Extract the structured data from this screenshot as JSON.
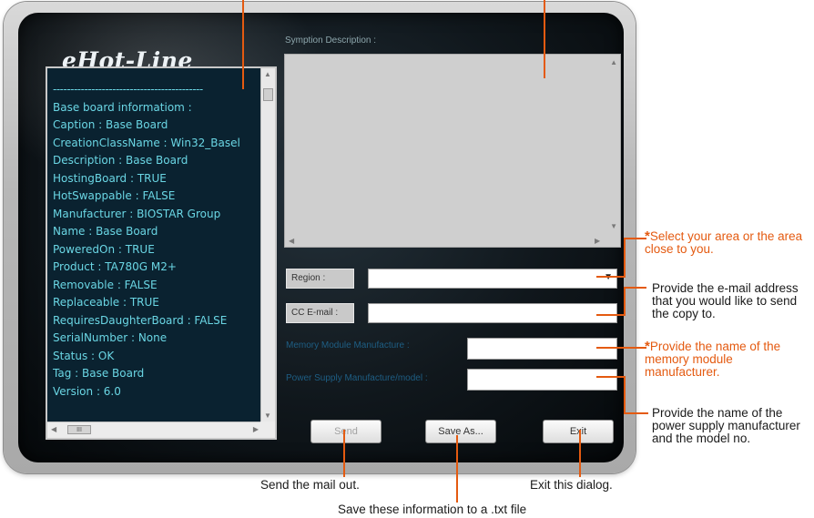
{
  "window": {
    "title": "eHot-Line"
  },
  "info_list": {
    "separator": "-------------------------------------------",
    "lines": [
      "Base board informatiom :",
      "Caption : Base Board",
      "CreationClassName : Win32_Basel",
      "Description : Base Board",
      "HostingBoard : TRUE",
      "HotSwappable : FALSE",
      "Manufacturer : BIOSTAR Group",
      "Name : Base Board",
      "PoweredOn : TRUE",
      "Product : TA780G M2+",
      "Removable : FALSE",
      "Replaceable : TRUE",
      "RequiresDaughterBoard : FALSE",
      "SerialNumber : None",
      "Status : OK",
      "Tag : Base Board",
      "Version : 6.0"
    ],
    "hscroll_grip": "III"
  },
  "symptom": {
    "label": "Symption Description :",
    "value": ""
  },
  "form": {
    "region_label": "Region :",
    "region_value": "",
    "cc_label": "CC E-mail :",
    "cc_value": "",
    "memory_label": "Memory Module Manufacture :",
    "memory_value": "",
    "psu_label": "Power Supply Manufacture/model :",
    "psu_value": ""
  },
  "buttons": {
    "send": "Send",
    "save_as": "Save As...",
    "exit": "Exit"
  },
  "annotations": {
    "region": {
      "star": "*",
      "text": "Select your area or the area close to you."
    },
    "cc": {
      "text": "Provide the e-mail address that you would like to send the copy to."
    },
    "memory": {
      "star": "*",
      "text": "Provide the name of the memory module manufacturer."
    },
    "psu": {
      "text": "Provide the name of the power supply manufacturer and the model no."
    },
    "send": "Send the mail out.",
    "exit": "Exit this dialog.",
    "save": "Save these information to a .txt file"
  },
  "colors": {
    "accent": "#e45a10",
    "list_text": "#6ad6e4",
    "list_bg": "#0a2230"
  }
}
